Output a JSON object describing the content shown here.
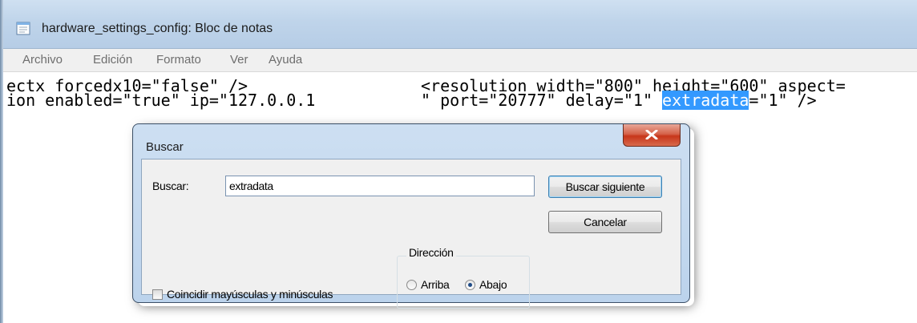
{
  "window": {
    "title": "hardware_settings_config: Bloc de notas"
  },
  "menu": {
    "items": [
      "Archivo",
      "Edición",
      "Formato",
      "Ver",
      "Ayuda"
    ]
  },
  "editor": {
    "line1_left": "ectx forcedx10=\"false\" />",
    "line1_right": "<resolution width=\"800\" height=\"600\" aspect=",
    "line2_left": "ion enabled=\"true\" ip=\"127.0.0.1",
    "line2_right_before": "\" port=\"20777\" delay=\"1\" ",
    "line2_highlight": "extradata",
    "line2_right_after": "=\"1\" />"
  },
  "dialog": {
    "title": "Buscar",
    "search_label": "Buscar:",
    "search_value": "extradata",
    "find_next_label": "Buscar siguiente",
    "cancel_label": "Cancelar",
    "direction_label": "Dirección",
    "up_label": "Arriba",
    "down_label": "Abajo",
    "direction_selected": "Abajo",
    "match_case_label": "Coincidir mayúsculas y minúsculas",
    "match_case_checked": false
  },
  "colors": {
    "selection": "#3399ff",
    "titlebar": "#bfd4ea",
    "close_button": "#c7361a"
  }
}
